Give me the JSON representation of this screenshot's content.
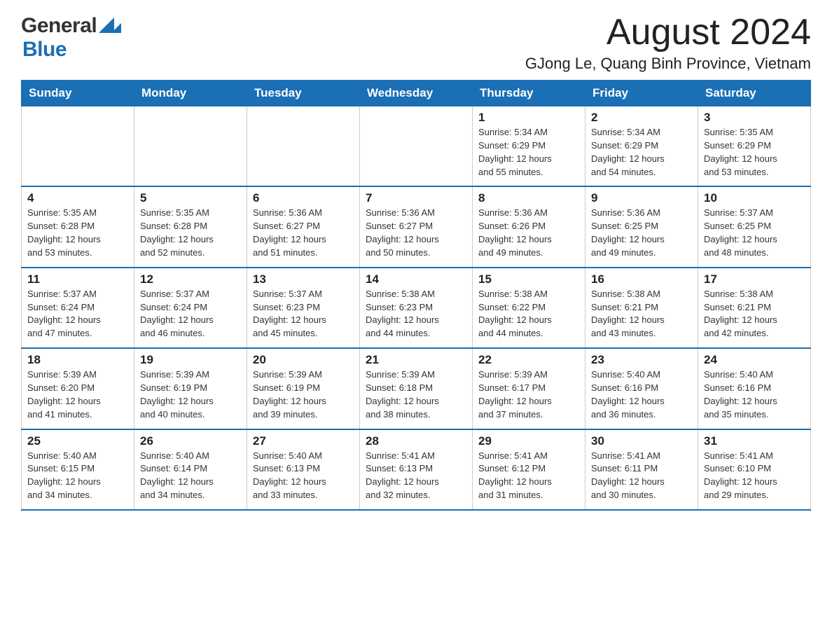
{
  "header": {
    "logo_general": "General",
    "logo_blue": "Blue",
    "month_title": "August 2024",
    "location": "GJong Le, Quang Binh Province, Vietnam"
  },
  "calendar": {
    "days_of_week": [
      "Sunday",
      "Monday",
      "Tuesday",
      "Wednesday",
      "Thursday",
      "Friday",
      "Saturday"
    ],
    "weeks": [
      [
        {
          "day": "",
          "info": ""
        },
        {
          "day": "",
          "info": ""
        },
        {
          "day": "",
          "info": ""
        },
        {
          "day": "",
          "info": ""
        },
        {
          "day": "1",
          "info": "Sunrise: 5:34 AM\nSunset: 6:29 PM\nDaylight: 12 hours\nand 55 minutes."
        },
        {
          "day": "2",
          "info": "Sunrise: 5:34 AM\nSunset: 6:29 PM\nDaylight: 12 hours\nand 54 minutes."
        },
        {
          "day": "3",
          "info": "Sunrise: 5:35 AM\nSunset: 6:29 PM\nDaylight: 12 hours\nand 53 minutes."
        }
      ],
      [
        {
          "day": "4",
          "info": "Sunrise: 5:35 AM\nSunset: 6:28 PM\nDaylight: 12 hours\nand 53 minutes."
        },
        {
          "day": "5",
          "info": "Sunrise: 5:35 AM\nSunset: 6:28 PM\nDaylight: 12 hours\nand 52 minutes."
        },
        {
          "day": "6",
          "info": "Sunrise: 5:36 AM\nSunset: 6:27 PM\nDaylight: 12 hours\nand 51 minutes."
        },
        {
          "day": "7",
          "info": "Sunrise: 5:36 AM\nSunset: 6:27 PM\nDaylight: 12 hours\nand 50 minutes."
        },
        {
          "day": "8",
          "info": "Sunrise: 5:36 AM\nSunset: 6:26 PM\nDaylight: 12 hours\nand 49 minutes."
        },
        {
          "day": "9",
          "info": "Sunrise: 5:36 AM\nSunset: 6:25 PM\nDaylight: 12 hours\nand 49 minutes."
        },
        {
          "day": "10",
          "info": "Sunrise: 5:37 AM\nSunset: 6:25 PM\nDaylight: 12 hours\nand 48 minutes."
        }
      ],
      [
        {
          "day": "11",
          "info": "Sunrise: 5:37 AM\nSunset: 6:24 PM\nDaylight: 12 hours\nand 47 minutes."
        },
        {
          "day": "12",
          "info": "Sunrise: 5:37 AM\nSunset: 6:24 PM\nDaylight: 12 hours\nand 46 minutes."
        },
        {
          "day": "13",
          "info": "Sunrise: 5:37 AM\nSunset: 6:23 PM\nDaylight: 12 hours\nand 45 minutes."
        },
        {
          "day": "14",
          "info": "Sunrise: 5:38 AM\nSunset: 6:23 PM\nDaylight: 12 hours\nand 44 minutes."
        },
        {
          "day": "15",
          "info": "Sunrise: 5:38 AM\nSunset: 6:22 PM\nDaylight: 12 hours\nand 44 minutes."
        },
        {
          "day": "16",
          "info": "Sunrise: 5:38 AM\nSunset: 6:21 PM\nDaylight: 12 hours\nand 43 minutes."
        },
        {
          "day": "17",
          "info": "Sunrise: 5:38 AM\nSunset: 6:21 PM\nDaylight: 12 hours\nand 42 minutes."
        }
      ],
      [
        {
          "day": "18",
          "info": "Sunrise: 5:39 AM\nSunset: 6:20 PM\nDaylight: 12 hours\nand 41 minutes."
        },
        {
          "day": "19",
          "info": "Sunrise: 5:39 AM\nSunset: 6:19 PM\nDaylight: 12 hours\nand 40 minutes."
        },
        {
          "day": "20",
          "info": "Sunrise: 5:39 AM\nSunset: 6:19 PM\nDaylight: 12 hours\nand 39 minutes."
        },
        {
          "day": "21",
          "info": "Sunrise: 5:39 AM\nSunset: 6:18 PM\nDaylight: 12 hours\nand 38 minutes."
        },
        {
          "day": "22",
          "info": "Sunrise: 5:39 AM\nSunset: 6:17 PM\nDaylight: 12 hours\nand 37 minutes."
        },
        {
          "day": "23",
          "info": "Sunrise: 5:40 AM\nSunset: 6:16 PM\nDaylight: 12 hours\nand 36 minutes."
        },
        {
          "day": "24",
          "info": "Sunrise: 5:40 AM\nSunset: 6:16 PM\nDaylight: 12 hours\nand 35 minutes."
        }
      ],
      [
        {
          "day": "25",
          "info": "Sunrise: 5:40 AM\nSunset: 6:15 PM\nDaylight: 12 hours\nand 34 minutes."
        },
        {
          "day": "26",
          "info": "Sunrise: 5:40 AM\nSunset: 6:14 PM\nDaylight: 12 hours\nand 34 minutes."
        },
        {
          "day": "27",
          "info": "Sunrise: 5:40 AM\nSunset: 6:13 PM\nDaylight: 12 hours\nand 33 minutes."
        },
        {
          "day": "28",
          "info": "Sunrise: 5:41 AM\nSunset: 6:13 PM\nDaylight: 12 hours\nand 32 minutes."
        },
        {
          "day": "29",
          "info": "Sunrise: 5:41 AM\nSunset: 6:12 PM\nDaylight: 12 hours\nand 31 minutes."
        },
        {
          "day": "30",
          "info": "Sunrise: 5:41 AM\nSunset: 6:11 PM\nDaylight: 12 hours\nand 30 minutes."
        },
        {
          "day": "31",
          "info": "Sunrise: 5:41 AM\nSunset: 6:10 PM\nDaylight: 12 hours\nand 29 minutes."
        }
      ]
    ]
  }
}
